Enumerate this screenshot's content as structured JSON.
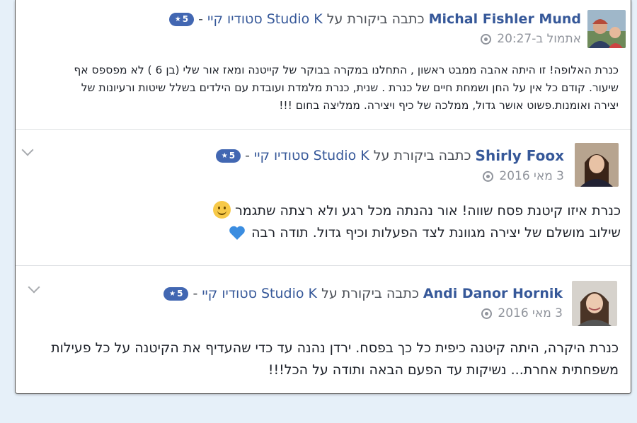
{
  "colors": {
    "name_link": "#365899",
    "badge": "#4267b2",
    "meta_gray": "#90949c",
    "body_text": "#1d2129",
    "page_bg": "#e6f0f9"
  },
  "reviews": [
    {
      "reviewer": "Michal Fishler Mund",
      "action_text": "כתבה ביקורת על",
      "page_name": "Studio K סטודיו קיי",
      "separator": "-",
      "rating": "5",
      "rating_icon": "star-icon",
      "timestamp": "אתמול ב-20:27",
      "privacy_icon": "globe-icon",
      "lines": [
        "כנרת האלופה! זו היתה אהבה ממבט ראשון , התחלנו במקרה בבוקר של קייטנה ומאז אור שלי (בן 6 ) לא מפספס אף",
        "שיעור. קודם כל אין על החן ושמחת חיים של כנרת . שנית, כנרת מלמדת ועובדת עם הילדים בשלל שיטות ורעיונות של",
        "יצירה ואומנות.פשוט אושר גדול, ממלכה של כיף ויצירה. ממליצה בחום !!!"
      ]
    },
    {
      "reviewer": "Shirly Foox",
      "action_text": "כתבה ביקורת על",
      "page_name": "Studio K סטודיו קיי",
      "separator": "-",
      "rating": "5",
      "rating_icon": "star-icon",
      "timestamp": "3 מאי 2016",
      "privacy_icon": "globe-icon",
      "lines": [
        "כנרת איזו קיטנת פסח שווה! אור נהנתה מכל רגע ולא רצתה שתגמר",
        "שילוב מושלם של יצירה מגוונת לצד הפעלות וכיף גדול. תודה רבה"
      ],
      "emojis": [
        "smile-emoji-icon",
        "blue-heart-icon"
      ]
    },
    {
      "reviewer": "Andi Danor Hornik",
      "action_text": "כתבה ביקורת על",
      "page_name": "Studio K סטודיו קיי",
      "separator": "-",
      "rating": "5",
      "rating_icon": "star-icon",
      "timestamp": "3 מאי 2016",
      "privacy_icon": "globe-icon",
      "lines": [
        "כנרת היקרה, היתה קיטנה כיפית כל כך בפסח. ירדן נהנה עד כדי שהעדיף את הקיטנה על כל פעילות",
        "משפחתית אחרת... נשיקות עד הפעם הבאה ותודה על הכל!!!"
      ]
    }
  ]
}
